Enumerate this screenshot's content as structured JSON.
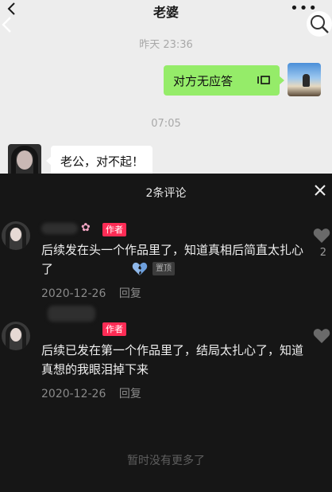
{
  "chat": {
    "title": "老婆",
    "more_icon": "more-dots-icon",
    "timestamps": [
      "昨天 23:36",
      "07:05"
    ],
    "outgoing_message": "对方无应答",
    "outgoing_icon": "voice-call-icon",
    "incoming_message": "老公，对不起！",
    "colors": {
      "background": "#ededed",
      "outgoing_bubble": "#95ec69",
      "incoming_bubble": "#ffffff"
    }
  },
  "comments_sheet": {
    "title": "2条评论",
    "close_icon": "close-icon",
    "comments": [
      {
        "author_badge": "作者",
        "text": "后续发在头一个作品里了，知道真相后简直太扎心了",
        "emoji_icon": "broken-heart-icon",
        "pinned_label": "置顶",
        "date": "2020-12-26",
        "reply_label": "回复",
        "like_count": "2"
      },
      {
        "author_badge": "作者",
        "text": "后续已发在第一个作品里了，结局太扎心了，知道真想的我眼泪掉下来",
        "date": "2020-12-26",
        "reply_label": "回复"
      }
    ],
    "footer": "暂时没有更多了",
    "colors": {
      "background": "#161616",
      "author_badge": "#fe2c55",
      "text": "#f0f0f0",
      "meta": "#8a8a8a"
    }
  }
}
